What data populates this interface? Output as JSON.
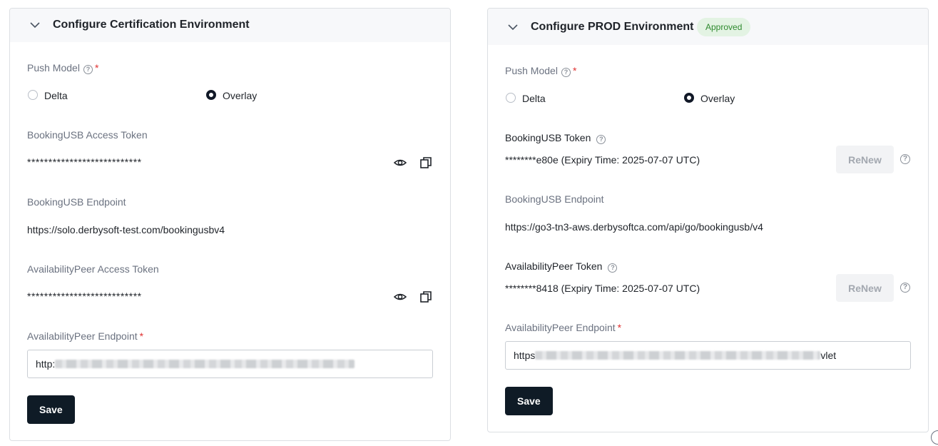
{
  "left_panel": {
    "title": "Configure Certification Environment",
    "push_model": {
      "label": "Push Model",
      "required_mark": "*",
      "options": [
        {
          "label": "Delta",
          "selected": false
        },
        {
          "label": "Overlay",
          "selected": true
        }
      ]
    },
    "booking_token": {
      "label": "BookingUSB Access Token",
      "value": "***************************"
    },
    "booking_endpoint": {
      "label": "BookingUSB Endpoint",
      "value": "https://solo.derbysoft-test.com/bookingusbv4"
    },
    "availability_token": {
      "label": "AvailabilityPeer Access Token",
      "value": "***************************"
    },
    "availability_endpoint": {
      "label": "AvailabilityPeer Endpoint",
      "required_mark": "*",
      "value_visible_prefix": "http:"
    },
    "save_label": "Save"
  },
  "right_panel": {
    "title": "Configure PROD Environment",
    "badge": "Approved",
    "push_model": {
      "label": "Push Model",
      "required_mark": "*",
      "options": [
        {
          "label": "Delta",
          "selected": false
        },
        {
          "label": "Overlay",
          "selected": true
        }
      ]
    },
    "booking_token": {
      "label": "BookingUSB Token",
      "value": "********e80e (Expiry Time: 2025-07-07 UTC)",
      "renew_label": "ReNew"
    },
    "booking_endpoint": {
      "label": "BookingUSB Endpoint",
      "value": "https://go3-tn3-aws.derbysoftca.com/api/go/bookingusb/v4"
    },
    "availability_token": {
      "label": "AvailabilityPeer Token",
      "value": "********8418 (Expiry Time: 2025-07-07 UTC)",
      "renew_label": "ReNew"
    },
    "availability_endpoint": {
      "label": "AvailabilityPeer Endpoint",
      "required_mark": "*",
      "value_visible_prefix": "https",
      "value_visible_suffix": "vlet"
    },
    "save_label": "Save"
  },
  "icons": {
    "help": "?",
    "colors": {
      "primary_button": "#0f1b26",
      "badge_bg": "#e3f3e3",
      "badge_text": "#2f8a2f",
      "required": "#e03131"
    }
  }
}
